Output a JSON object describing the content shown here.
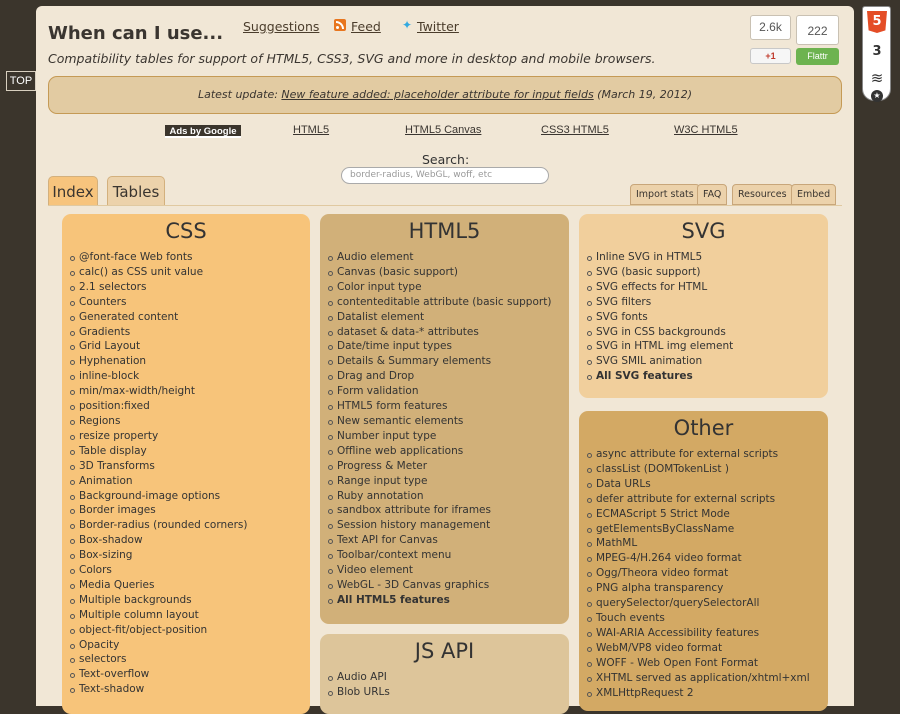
{
  "top_link": "TOP",
  "header": {
    "title": "When can I use...",
    "suggestions": "Suggestions",
    "feed": "Feed",
    "twitter": "Twitter",
    "subtitle": "Compatibility tables for support of HTML5, CSS3, SVG and more in desktop and mobile browsers.",
    "share_count": "2.6k",
    "flattr_count": "222",
    "gplus_label": "+1",
    "flattr_label": "Flattr"
  },
  "update": {
    "prefix": "Latest update: ",
    "link": "New feature added: placeholder attribute for input fields",
    "suffix": " (March 19, 2012)"
  },
  "ads": {
    "label": "Ads by Google",
    "links": [
      "HTML5",
      "HTML5 Canvas",
      "CSS3 HTML5",
      "W3C HTML5"
    ]
  },
  "search": {
    "label": "Search:",
    "placeholder": "border-radius, WebGL, woff, etc"
  },
  "tabs": [
    "Index",
    "Tables"
  ],
  "tools": [
    "Import stats",
    "FAQ",
    "Resources",
    "Embed"
  ],
  "boxes": {
    "css": {
      "title": "CSS",
      "items": [
        "@font-face Web fonts",
        "calc() as CSS unit value",
        "2.1 selectors",
        "Counters",
        "Generated content",
        "Gradients",
        "Grid Layout",
        "Hyphenation",
        "inline-block",
        "min/max-width/height",
        "position:fixed",
        "Regions",
        "resize property",
        "Table display",
        "3D Transforms",
        "Animation",
        "Background-image options",
        "Border images",
        "Border-radius (rounded corners)",
        "Box-shadow",
        "Box-sizing",
        "Colors",
        "Media Queries",
        "Multiple backgrounds",
        "Multiple column layout",
        "object-fit/object-position",
        "Opacity",
        "selectors",
        "Text-overflow",
        "Text-shadow"
      ]
    },
    "html5": {
      "title": "HTML5",
      "items": [
        "Audio element",
        "Canvas (basic support)",
        "Color input type",
        "contenteditable attribute (basic support)",
        "Datalist element",
        "dataset & data-* attributes",
        "Date/time input types",
        "Details & Summary elements",
        "Drag and Drop",
        "Form validation",
        "HTML5 form features",
        "New semantic elements",
        "Number input type",
        "Offline web applications",
        "Progress & Meter",
        "Range input type",
        "Ruby annotation",
        "sandbox attribute for iframes",
        "Session history management",
        "Text API for Canvas",
        "Toolbar/context menu",
        "Video element",
        "WebGL - 3D Canvas graphics"
      ],
      "all": "All HTML5 features"
    },
    "svg": {
      "title": "SVG",
      "items": [
        "Inline SVG in HTML5",
        "SVG (basic support)",
        "SVG effects for HTML",
        "SVG filters",
        "SVG fonts",
        "SVG in CSS backgrounds",
        "SVG in HTML img element",
        "SVG SMIL animation"
      ],
      "all": "All SVG features"
    },
    "other": {
      "title": "Other",
      "items": [
        "async attribute for external scripts",
        "classList (DOMTokenList )",
        "Data URLs",
        "defer attribute for external scripts",
        "ECMAScript 5 Strict Mode",
        "getElementsByClassName",
        "MathML",
        "MPEG-4/H.264 video format",
        "Ogg/Theora video format",
        "PNG alpha transparency",
        "querySelector/querySelectorAll",
        "Touch events",
        "WAI-ARIA Accessibility features",
        "WebM/VP8 video format",
        "WOFF - Web Open Font Format",
        "XHTML served as application/xhtml+xml",
        "XMLHttpRequest 2"
      ]
    },
    "jsapi": {
      "title": "JS API",
      "items": [
        "Audio API",
        "Blob URLs"
      ]
    }
  },
  "badge": {
    "html5": "5",
    "css3": "3",
    "semantics": "≋",
    "star": "★"
  }
}
